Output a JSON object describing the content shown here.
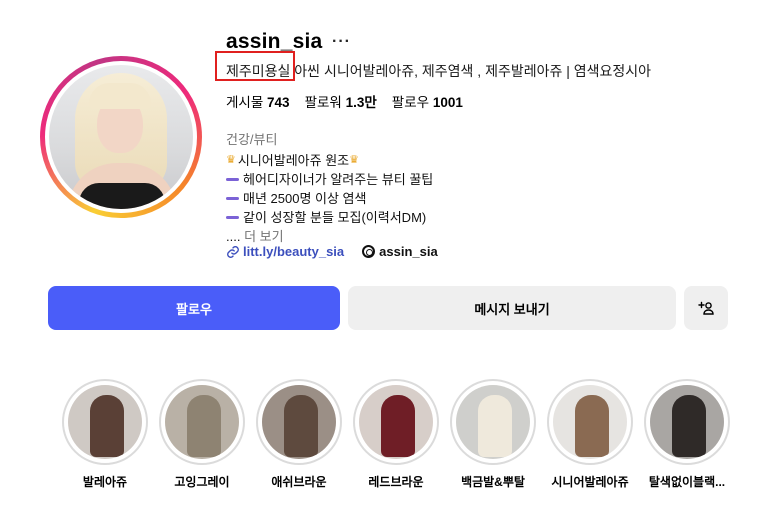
{
  "profile": {
    "username": "assin_sia",
    "more": "···",
    "full_name": "제주미용실 아씬 시니어발레아쥬, 제주염색 , 제주발레아쥬 | 염색요정시아",
    "stats": {
      "posts_label": "게시물",
      "posts": "743",
      "followers_label": "팔로워",
      "followers": "1.3만",
      "following_label": "팔로우",
      "following": "1001"
    },
    "category": "건강/뷰티",
    "bio": {
      "line1": "시니어발레아쥬 원조",
      "line2": "헤어디자이너가 알려주는 뷰티 꿀팁",
      "line3": "매년 2500명 이상 염색",
      "line4": "같이 성장할 분들 모집(이력서DM)",
      "more_prefix": "....",
      "more_label": "더 보기"
    },
    "link": "litt.ly/beauty_sia",
    "threads_handle": "assin_sia"
  },
  "actions": {
    "follow": "팔로우",
    "message": "메시지 보내기",
    "add_user": "+⚇"
  },
  "highlights": [
    {
      "label": "발레아쥬",
      "bg": "#cfc9c4",
      "hair": "#5a4036"
    },
    {
      "label": "고잉그레이",
      "bg": "#b9b1a6",
      "hair": "#8e8372"
    },
    {
      "label": "애쉬브라운",
      "bg": "#9b8f86",
      "hair": "#5e4a3e"
    },
    {
      "label": "레드브라운",
      "bg": "#d7cec9",
      "hair": "#6f1e26"
    },
    {
      "label": "백금발&뿌탈",
      "bg": "#cfcfcc",
      "hair": "#efe9dc"
    },
    {
      "label": "시니어발레아쥬",
      "bg": "#e6e4e1",
      "hair": "#8a6a52"
    },
    {
      "label": "탈색없이블랙...",
      "bg": "#a9a6a3",
      "hair": "#2f2a28"
    }
  ],
  "colors": {
    "accent": "#4a5df9",
    "highlight_box": "#e0201f",
    "link": "#3c4fbd"
  }
}
